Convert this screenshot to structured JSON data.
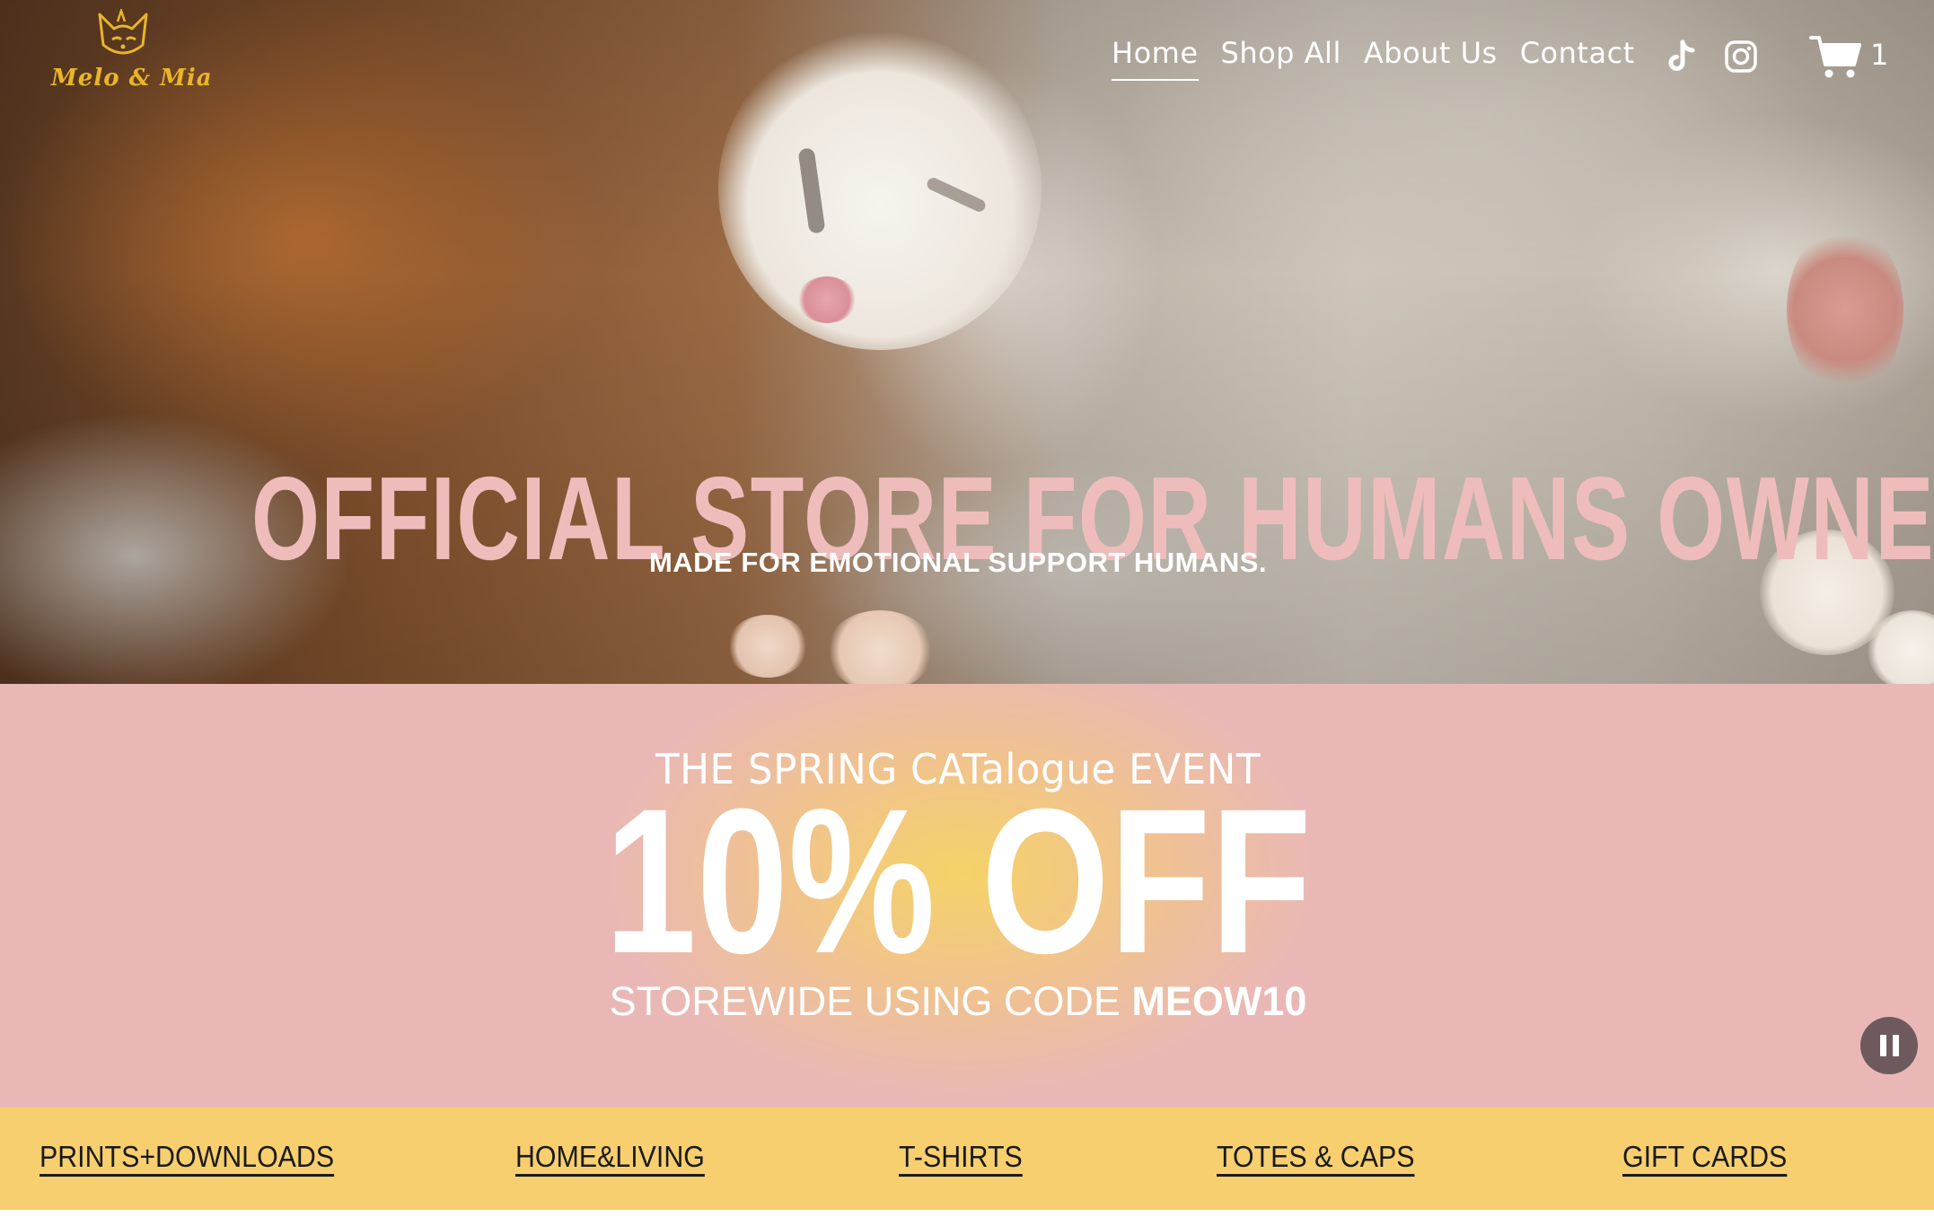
{
  "brand": {
    "logo_text": "Melo & Mia",
    "logo_color": "#e8b628"
  },
  "nav": {
    "items": [
      {
        "label": "Home",
        "active": true
      },
      {
        "label": "Shop All"
      },
      {
        "label": "About Us"
      },
      {
        "label": "Contact"
      }
    ]
  },
  "social": {
    "icons": [
      "tiktok-icon",
      "instagram-icon"
    ]
  },
  "cart": {
    "count": "1",
    "icon": "cart-icon"
  },
  "hero": {
    "title": "OFFICIAL STORE FOR HUMANS OWNED BY CATS",
    "subtitle": "MADE FOR EMOTIONAL SUPPORT HUMANS.",
    "title_color": "#eebdbb"
  },
  "promo": {
    "eyebrow": "THE SPRING CATalogue EVENT",
    "headline": "10% OFF",
    "code_prefix": "STOREWIDE USING CODE ",
    "code": "MEOW10",
    "background": "#e9b8b6",
    "glow": "#f6d464",
    "pause_icon": "pause-icon"
  },
  "categories": {
    "background": "#f8cf6e",
    "items": [
      {
        "label": "PRINTS+DOWNLOADS"
      },
      {
        "label": "HOME&LIVING"
      },
      {
        "label": "T-SHIRTS"
      },
      {
        "label": "TOTES & CAPS"
      },
      {
        "label": "GIFT CARDS"
      }
    ]
  }
}
